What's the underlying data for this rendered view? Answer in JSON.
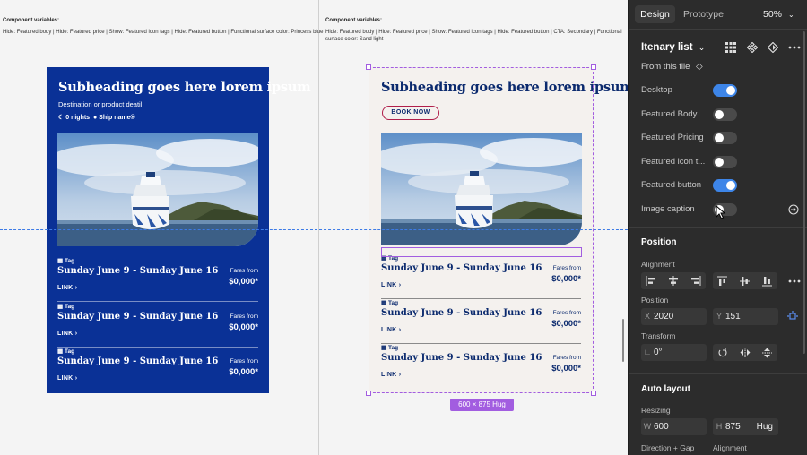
{
  "canvas": {
    "left_variant": {
      "vars_label": "Component variables:",
      "vars_text": "Hide: Featured body | Hide: Featured price | Show: Featured icon tags | Hide: Featured button | Functional surface color: Princess blue"
    },
    "right_variant": {
      "vars_label": "Component variables:",
      "vars_text": "Hide: Featured body | Hide: Featured price | Show: Featured icon tags | Hide: Featured button | CTA: Secondary | Functional surface color: Sand light"
    },
    "cards": [
      {
        "heading": "Subheading goes here lorem ipsum",
        "destination": "Destination or product deatil",
        "nights": "0 nights",
        "ship": "Ship name®",
        "rows": [
          {
            "tag": "Tag",
            "date": "Sunday June 9 - Sunday June 16",
            "link": "LINK ›",
            "fares_label": "Fares from",
            "price": "$0,000*"
          },
          {
            "tag": "Tag",
            "date": "Sunday June 9 - Sunday June 16",
            "link": "LINK ›",
            "fares_label": "Fares from",
            "price": "$0,000*"
          },
          {
            "tag": "Tag",
            "date": "Sunday June 9 - Sunday June 16",
            "link": "LINK ›",
            "fares_label": "Fares from",
            "price": "$0,000*"
          }
        ]
      },
      {
        "heading": "Subheading goes here lorem ipsum",
        "button": "BOOK NOW",
        "rows": [
          {
            "tag": "Tag",
            "date": "Sunday June 9 - Sunday June 16",
            "link": "LINK ›",
            "fares_label": "Fares from",
            "price": "$0,000*"
          },
          {
            "tag": "Tag",
            "date": "Sunday June 9 - Sunday June 16",
            "link": "LINK ›",
            "fares_label": "Fares from",
            "price": "$0,000*"
          },
          {
            "tag": "Tag",
            "date": "Sunday June 9 - Sunday June 16",
            "link": "LINK ›",
            "fares_label": "Fares from",
            "price": "$0,000*"
          }
        ]
      }
    ],
    "size_badge": "600 × 875 Hug"
  },
  "panel": {
    "tabs": {
      "design": "Design",
      "prototype": "Prototype"
    },
    "zoom": "50%",
    "component": {
      "name": "Itenary list",
      "source": "From this file",
      "properties": [
        {
          "label": "Desktop",
          "on": true
        },
        {
          "label": "Featured Body",
          "on": false
        },
        {
          "label": "Featured Pricing",
          "on": false
        },
        {
          "label": "Featured icon t...",
          "on": false
        },
        {
          "label": "Featured button",
          "on": true
        },
        {
          "label": "Image caption",
          "on": false
        }
      ]
    },
    "position": {
      "title": "Position",
      "alignment_label": "Alignment",
      "position_label": "Position",
      "x_label": "X",
      "x_value": "2020",
      "y_label": "Y",
      "y_value": "151",
      "transform_label": "Transform",
      "rotation": "0°"
    },
    "auto_layout": {
      "title": "Auto layout",
      "resizing_label": "Resizing",
      "w_label": "W",
      "w_value": "600",
      "h_label": "H",
      "h_value": "875",
      "h_mode": "Hug",
      "direction_label": "Direction + Gap",
      "alignment_label": "Alignment"
    }
  },
  "colors": {
    "princess_blue": "#0a3196",
    "sand_light": "#f4f1ee",
    "selection": "#a25de0",
    "toggle_on": "#3d85e8",
    "cta_border": "#b01e4a"
  }
}
